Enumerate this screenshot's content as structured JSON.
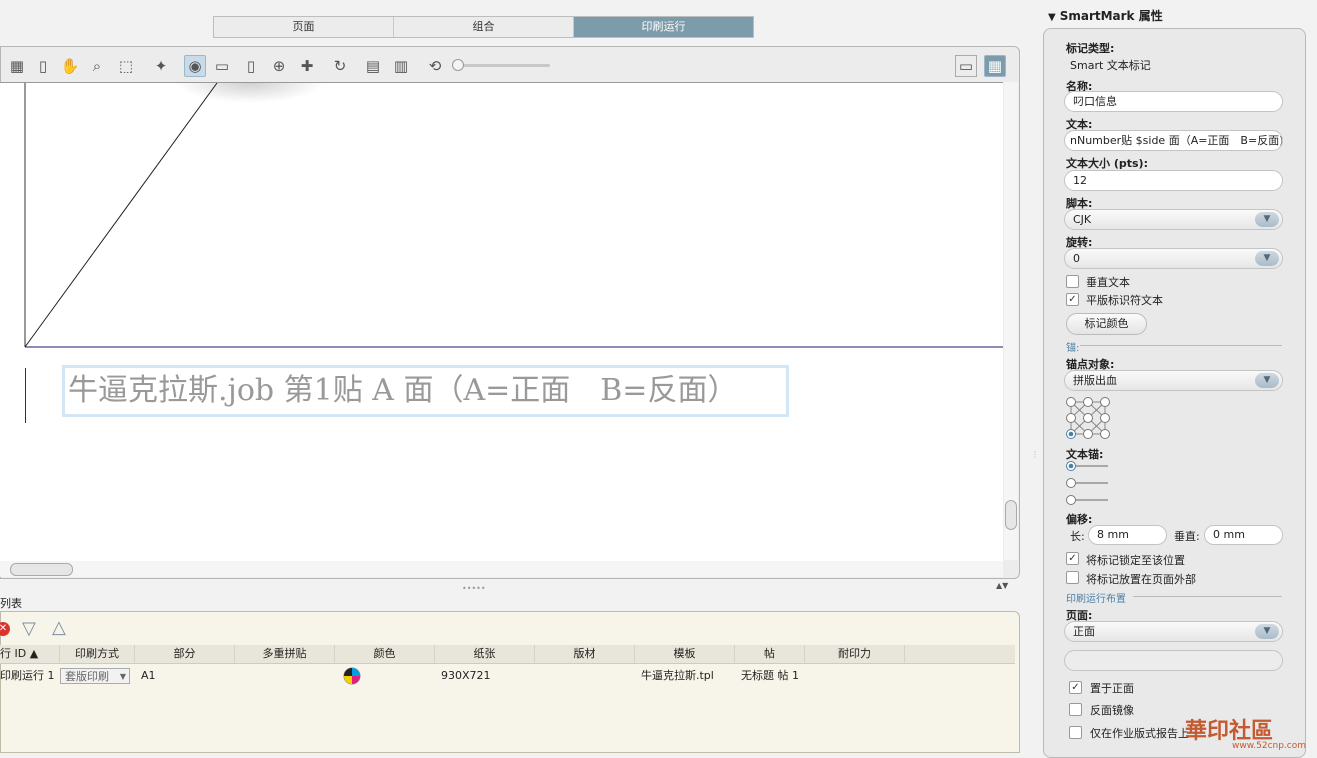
{
  "tabs": [
    "页面",
    "组合",
    "印刷运行"
  ],
  "active_tab": "印刷运行",
  "canvas": {
    "text_mark": "牛逼克拉斯.job 第1贴 A 面（A=正面　B=反面）"
  },
  "list": {
    "title": "列表",
    "columns": [
      "行 ID ▲",
      "印刷方式",
      "部分",
      "多重拼贴",
      "颜色",
      "纸张",
      "版材",
      "模板",
      "帖",
      "耐印力"
    ],
    "rows": [
      {
        "id": "印刷运行 1",
        "method": "套版印刷",
        "part": "A1",
        "multi": "",
        "paper": "930X721",
        "plate": "",
        "template": "牛逼克拉斯.tpl",
        "signature": "无标题 帖 1",
        "durability": ""
      }
    ]
  },
  "panel": {
    "title": "SmartMark 属性",
    "mark_type_label": "标记类型:",
    "mark_type_value": "Smart 文本标记",
    "name_label": "名称:",
    "name_value": "叼口信息",
    "text_label": "文本:",
    "text_value": "nNumber贴 $side 面（A=正面　B=反面)",
    "size_label": "文本大小 (pts):",
    "size_value": "12",
    "script_label": "脚本:",
    "script_value": "CJK",
    "rotate_label": "旋转:",
    "rotate_value": "0",
    "vertical_text": "垂直文本",
    "plate_id_text": "平版标识符文本",
    "mark_color_btn": "标记颜色",
    "anchor_section": "锚:",
    "anchor_object_label": "锚点对象:",
    "anchor_object_value": "拼版出血",
    "text_anchor_label": "文本锚:",
    "offset_label": "偏移:",
    "offset_h_label": "长:",
    "offset_h_value": "8 mm",
    "offset_v_label": "垂直:",
    "offset_v_value": "0 mm",
    "lock_label": "将标记锁定至该位置",
    "outside_label": "将标记放置在页面外部",
    "layout_section": "印刷运行布置",
    "page_label": "页面:",
    "page_value": "正面",
    "front_label": "置于正面",
    "mirror_label": "反面镜像",
    "report_label": "仅在作业版式报告上"
  },
  "watermark": {
    "main": "華印社區",
    "sub": "www.52cnp.com"
  }
}
